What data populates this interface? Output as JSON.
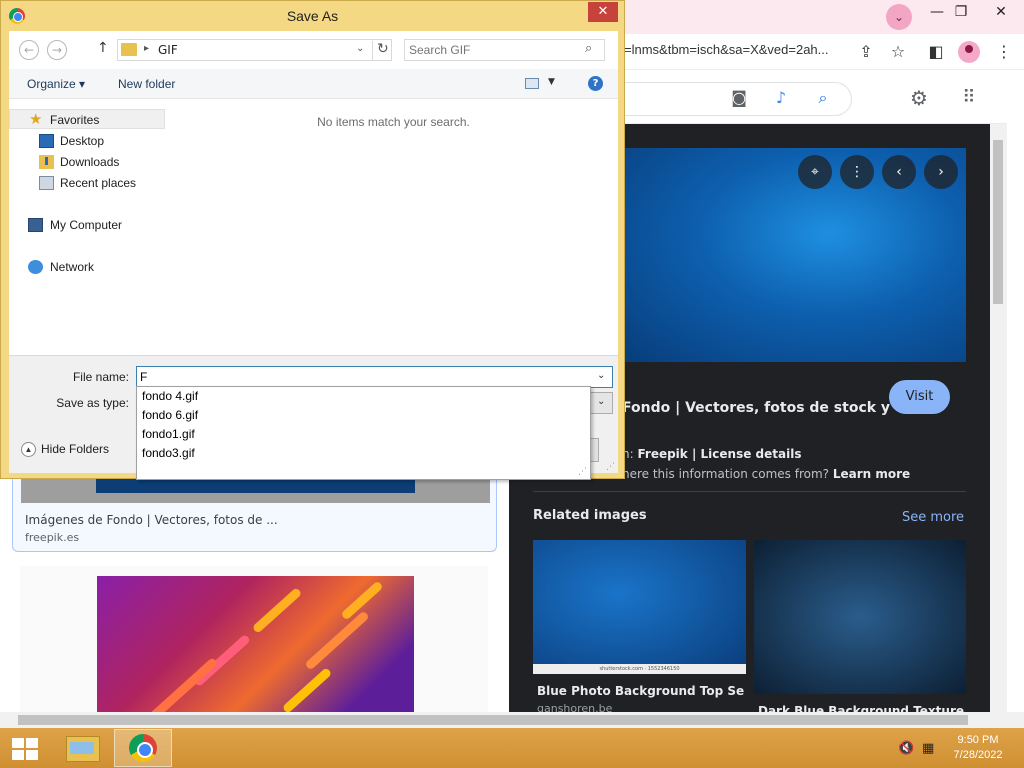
{
  "browser": {
    "url_fragment": "=lnms&tbm=isch&sa=X&ved=2ah...",
    "preview": {
      "title": "Fondo | Vectores, fotos de stock y",
      "visit_label": "Visit",
      "license_prefix": "n: ",
      "license_source": "Freepik",
      "license_sep": " | ",
      "license_details": "License details",
      "info_text": "here this information comes from? ",
      "learn_more": "Learn more",
      "related_title": "Related images",
      "see_more": "See more",
      "related": [
        {
          "caption": "Blue Photo Background Top Sellers,...",
          "source": "ganshoren.be",
          "watermark": "shutterstock.com · 1552346150"
        },
        {
          "caption": "Dark Blue Background Texture Stoc..."
        }
      ]
    },
    "results": {
      "card1_caption": "Imágenes de Fondo | Vectores, fotos de ...",
      "card1_source": "freepik.es"
    }
  },
  "dialog": {
    "title": "Save As",
    "close_glyph": "✕",
    "nav": {
      "back_glyph": "←",
      "forward_glyph": "→",
      "up_glyph": "↑",
      "path_folder": "GIF",
      "search_placeholder": "Search GIF"
    },
    "commands": {
      "organize": "Organize ▾",
      "new_folder": "New folder",
      "help_glyph": "?"
    },
    "nav_pane": {
      "favorites": "Favorites",
      "desktop": "Desktop",
      "downloads": "Downloads",
      "recent_places": "Recent places",
      "my_computer": "My Computer",
      "network": "Network"
    },
    "empty_message": "No items match your search.",
    "file_name_label": "File name:",
    "file_name_value": "F",
    "save_as_type_label": "Save as type:",
    "hide_folders": "Hide Folders",
    "autocomplete": [
      "fondo 4.gif",
      "fondo 6.gif",
      "fondo1.gif",
      "fondo3.gif"
    ]
  },
  "taskbar": {
    "time": "9:50 PM",
    "date": "7/28/2022"
  }
}
